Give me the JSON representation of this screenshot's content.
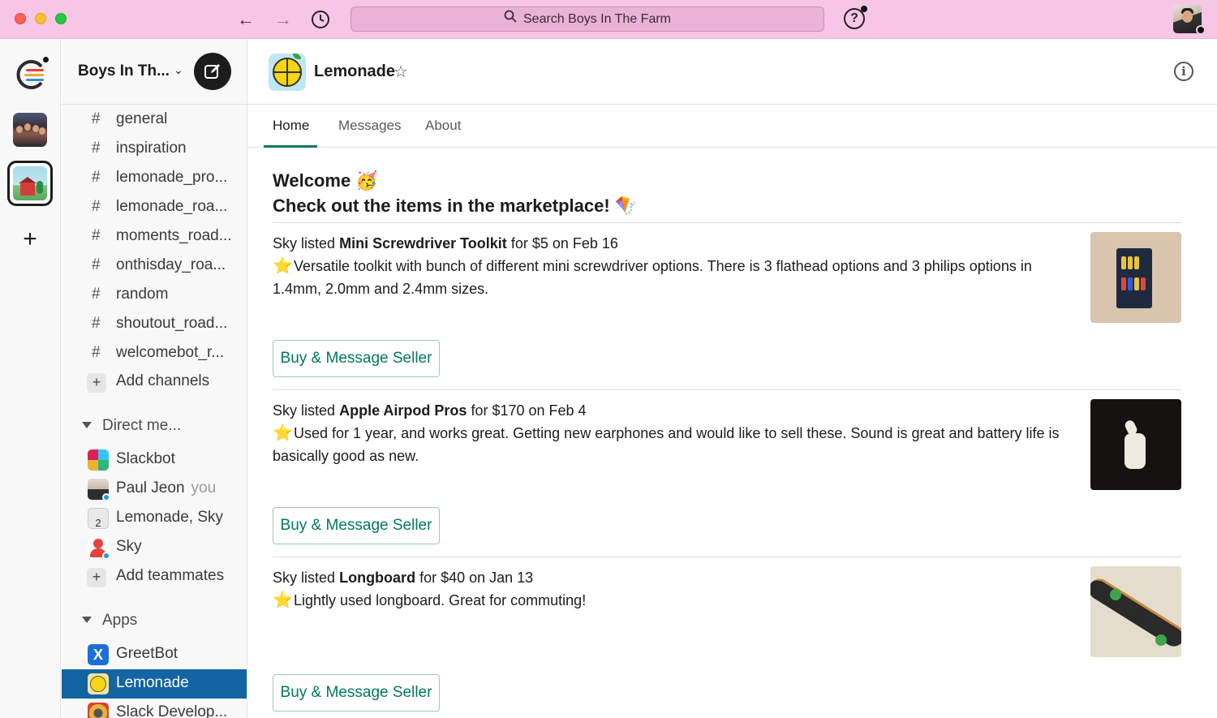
{
  "titlebar": {
    "search_placeholder": "Search Boys In The Farm"
  },
  "sidebar": {
    "workspace_name": "Boys In Th...",
    "channels": [
      {
        "label": "general"
      },
      {
        "label": "inspiration"
      },
      {
        "label": "lemonade_pro..."
      },
      {
        "label": "lemonade_roa..."
      },
      {
        "label": "moments_road..."
      },
      {
        "label": "onthisday_roa..."
      },
      {
        "label": "random"
      },
      {
        "label": "shoutout_road..."
      },
      {
        "label": "welcomebot_r..."
      }
    ],
    "add_channels": "Add channels",
    "dm_section": "Direct me...",
    "dms": [
      {
        "label": "Slackbot"
      },
      {
        "label": "Paul Jeon",
        "suffix": "you"
      },
      {
        "label": "Lemonade, Sky",
        "badge": "2"
      },
      {
        "label": "Sky"
      }
    ],
    "add_teammates": "Add teammates",
    "apps_section": "Apps",
    "apps": [
      {
        "label": "GreetBot"
      },
      {
        "label": "Lemonade"
      },
      {
        "label": "Slack Develop..."
      }
    ]
  },
  "main": {
    "app_title": "Lemonade",
    "tabs": [
      "Home",
      "Messages",
      "About"
    ],
    "active_tab": "Home",
    "welcome_line1": "Welcome 🥳",
    "welcome_line2": "Check out the items in the marketplace! 🪁",
    "listings": [
      {
        "seller": "Sky",
        "listed_word": "listed",
        "item": "Mini Screwdriver Toolkit",
        "price_text": "for $5 on Feb 16",
        "description": "Versatile toolkit with bunch of different mini screwdriver options. There is 3 flathead options and 3 philips options in 1.4mm, 2.0mm and 2.4mm sizes.",
        "button": "Buy & Message Seller"
      },
      {
        "seller": "Sky",
        "listed_word": "listed",
        "item": "Apple Airpod Pros",
        "price_text": "for $170 on Feb 4",
        "description": "Used for 1 year, and works great. Getting new earphones and would like to sell these. Sound is great and battery life is basically good as new.",
        "button": "Buy & Message Seller"
      },
      {
        "seller": "Sky",
        "listed_word": "listed",
        "item": "Longboard",
        "price_text": "for $40 on Jan 13",
        "description": "Lightly used longboard. Great for commuting!",
        "button": "Buy & Message Seller"
      }
    ]
  },
  "colors": {
    "titlebar": "#f7c6e6",
    "selected_item": "#1264a3",
    "button_text": "#007a5a"
  }
}
